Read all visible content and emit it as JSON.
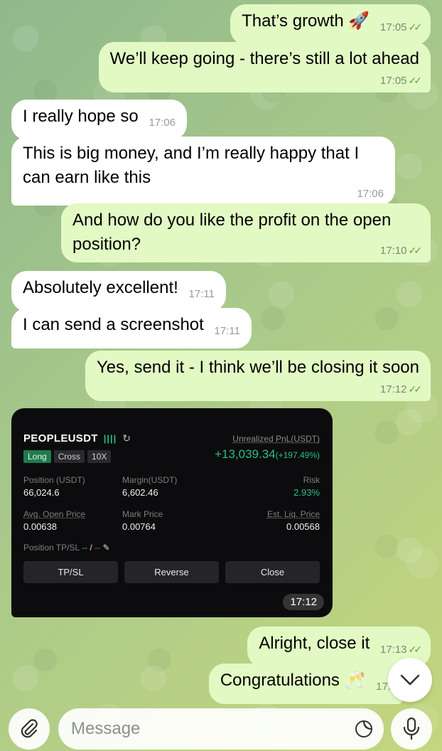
{
  "messages": [
    {
      "text": "That’s growth 🚀",
      "time": "17:05"
    },
    {
      "text": "We’ll keep going - there’s still a lot ahead",
      "time": "17:05"
    },
    {
      "text": "I really hope so",
      "time": "17:06"
    },
    {
      "text": "This is big money, and I’m really happy that I can earn like this",
      "time": "17:06"
    },
    {
      "text": "And how do you like the profit on the open position?",
      "time": "17:10"
    },
    {
      "text": "Absolutely excellent!",
      "time": "17:11"
    },
    {
      "text": "I can send a screenshot",
      "time": "17:11"
    },
    {
      "text": "Yes, send it - I think we’ll be closing it soon",
      "time": "17:12"
    },
    {
      "text": "Alright, close it",
      "time": "17:13"
    },
    {
      "text": "Congratulations 🥂",
      "time": "17:"
    }
  ],
  "screenshot": {
    "symbol": "PEOPLEUSDT",
    "bars": "||||",
    "pnl_label": "Unrealized PnL(USDT)",
    "tags": [
      "Long",
      "Cross",
      "10X"
    ],
    "pnl_value": "+13,039.34",
    "pnl_pct": "(+197.49%)",
    "labels": [
      "Position (USDT)",
      "Margin(USDT)",
      "Risk",
      "Avg. Open Price",
      "Mark Price",
      "Est. Liq. Price"
    ],
    "values": [
      "66,024.6",
      "6,602.46",
      "2.93%",
      "0.00638",
      "0.00764",
      "0.00568"
    ],
    "tpsl_label": "Position TP/SL",
    "tpsl_tp": "--",
    "tpsl_sep": "/",
    "tpsl_sl": "--",
    "buttons": [
      "TP/SL",
      "Reverse",
      "Close"
    ],
    "time": "17:12"
  },
  "composer": {
    "placeholder": "Message"
  },
  "colors": {
    "outgoing": "#e2f9c4",
    "incoming": "#ffffff",
    "profit": "#2ebd85"
  },
  "icons": {
    "attach": "paperclip-icon",
    "sticker": "sticker-icon",
    "mic": "microphone-icon",
    "scroll": "chevron-down-icon",
    "check": "double-check-icon"
  }
}
